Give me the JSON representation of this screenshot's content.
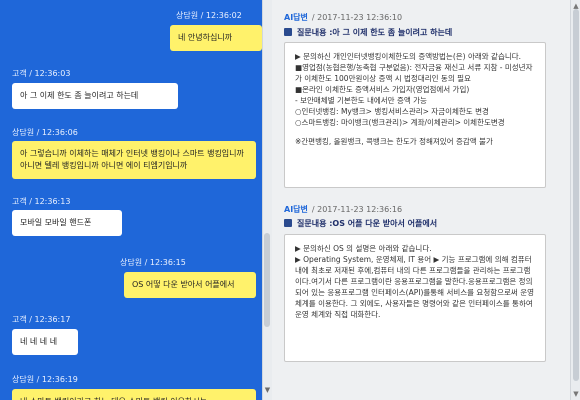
{
  "chat": {
    "messages": [
      {
        "meta": "상담원  /  12:36:02",
        "text": "네 안녕하십니까",
        "role": "agent"
      },
      {
        "meta": "고객  /  12:36:03",
        "text": "아 그 이제 한도 좀 늘이려고 하는데",
        "role": "customer"
      },
      {
        "meta": "상담원  /  12:36:06",
        "text": "아 그렇습니까 이체하는 매체가 인터넷 뱅킹이나 스마트 뱅킹입니까 아니면 텔레 뱅킹입니까 아니면 에이 티엠기입니까",
        "role": "agent"
      },
      {
        "meta": "고객  /  12:36:13",
        "text": "모바일 모바일 핸드폰",
        "role": "customer"
      },
      {
        "meta": "상담원  /  12:36:15",
        "text": "OS 어떻 다운 받아서 어플에서",
        "role": "agent"
      },
      {
        "meta": "고객  /  12:36:17",
        "text": "네 네 네 네",
        "role": "customer"
      },
      {
        "meta": "상담원  /  12:36:19",
        "text": "네 스마트 뱅킹이라고 하노 데요 스마트 뱅킹 이요하시는",
        "role": "agent"
      }
    ]
  },
  "ai_panel": {
    "answers": [
      {
        "name": "AI답변",
        "timestamp": "/ 2017-11-23 12:36:10",
        "question": "질문내용 :아 그 이제 한도 좀 늘이려고 하는데",
        "lines": [
          "▶ 문의하신 개인인터넷뱅킹이체한도의 증액방법는(은) 아래와 같습니다.",
          "■영업점(농협은행/농축협 구분없음): 전자금융 재신고 서류 지참 - 미성년자가 이체한도 100만원이상 증액 시 법정대리인 동의 필요",
          "■온라인 이체한도 증액서비스 가입자(영업점에서 가입)",
          "- 보안매체별 기본한도 내에서만 증액 가능",
          "○인터넷뱅킹: My뱅크> 뱅킹서비스관리> 자금이체한도 변경",
          "○스마트뱅킹: 마이뱅크(뱅크관리)> 계좌/이체관리> 이체한도변경",
          "※간편뱅킹, 올원뱅크, 콕뱅크는 한도가 정해져있어 증감액 불가"
        ]
      },
      {
        "name": "AI답변",
        "timestamp": "/ 2017-11-23 12:36:16",
        "question": "질문내용 :OS 어플 다운 받아서 어플에서",
        "lines": [
          "▶ 문의하신 OS 의 설명은 아래와 같습니다.",
          "▶ Operating System, 운영체제, IT 용어 ▶ 기능 프로그램에 의해 컴퓨터 내에 최초로 저재된 후에,컴퓨터 내의 다른 프로그램들을 관리하는 프로그램이다.여기서 다른 프로그램이란 응용프로그램을 말한다.응용프로그램은 정의되어 있는 응용프로그램 인터페이스(API)를통해 서비스를 요청함으로써 운영 체계를 이용한다. 그 외에도, 사용자들은 명령어와 같은 인터페이스를 통하여운영 체계와 직접 대화한다."
        ]
      }
    ]
  }
}
